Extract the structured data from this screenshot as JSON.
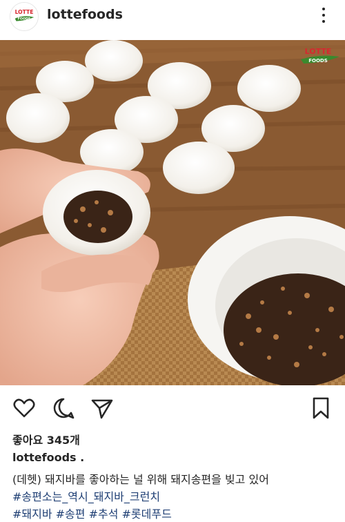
{
  "post": {
    "username": "lottefoods",
    "likes_text": "좋아요 345개",
    "caption_user": "lottefoods .",
    "caption_text": "(데헷) 돼지바를 좋아하는 널 위해  돼지송편을 빚고 있어",
    "hashtags_line1": "#송편소는_역시_돼지바_크런치",
    "hashtags_line2": "#돼지바 #송편 #추석 #롯데푸드"
  },
  "logo": {
    "avatar_text_top": "LOTTE",
    "avatar_text_bottom": "FOODS",
    "watermark_top": "LOTTE",
    "watermark_bottom": "FOODS"
  },
  "colors": {
    "text": "#262626",
    "hashtag": "#1f3f74",
    "brand_red": "#d7282f",
    "brand_green": "#3a8a2e"
  },
  "icons": [
    "heart-icon",
    "comment-icon",
    "share-icon",
    "bookmark-icon",
    "more-icon"
  ]
}
